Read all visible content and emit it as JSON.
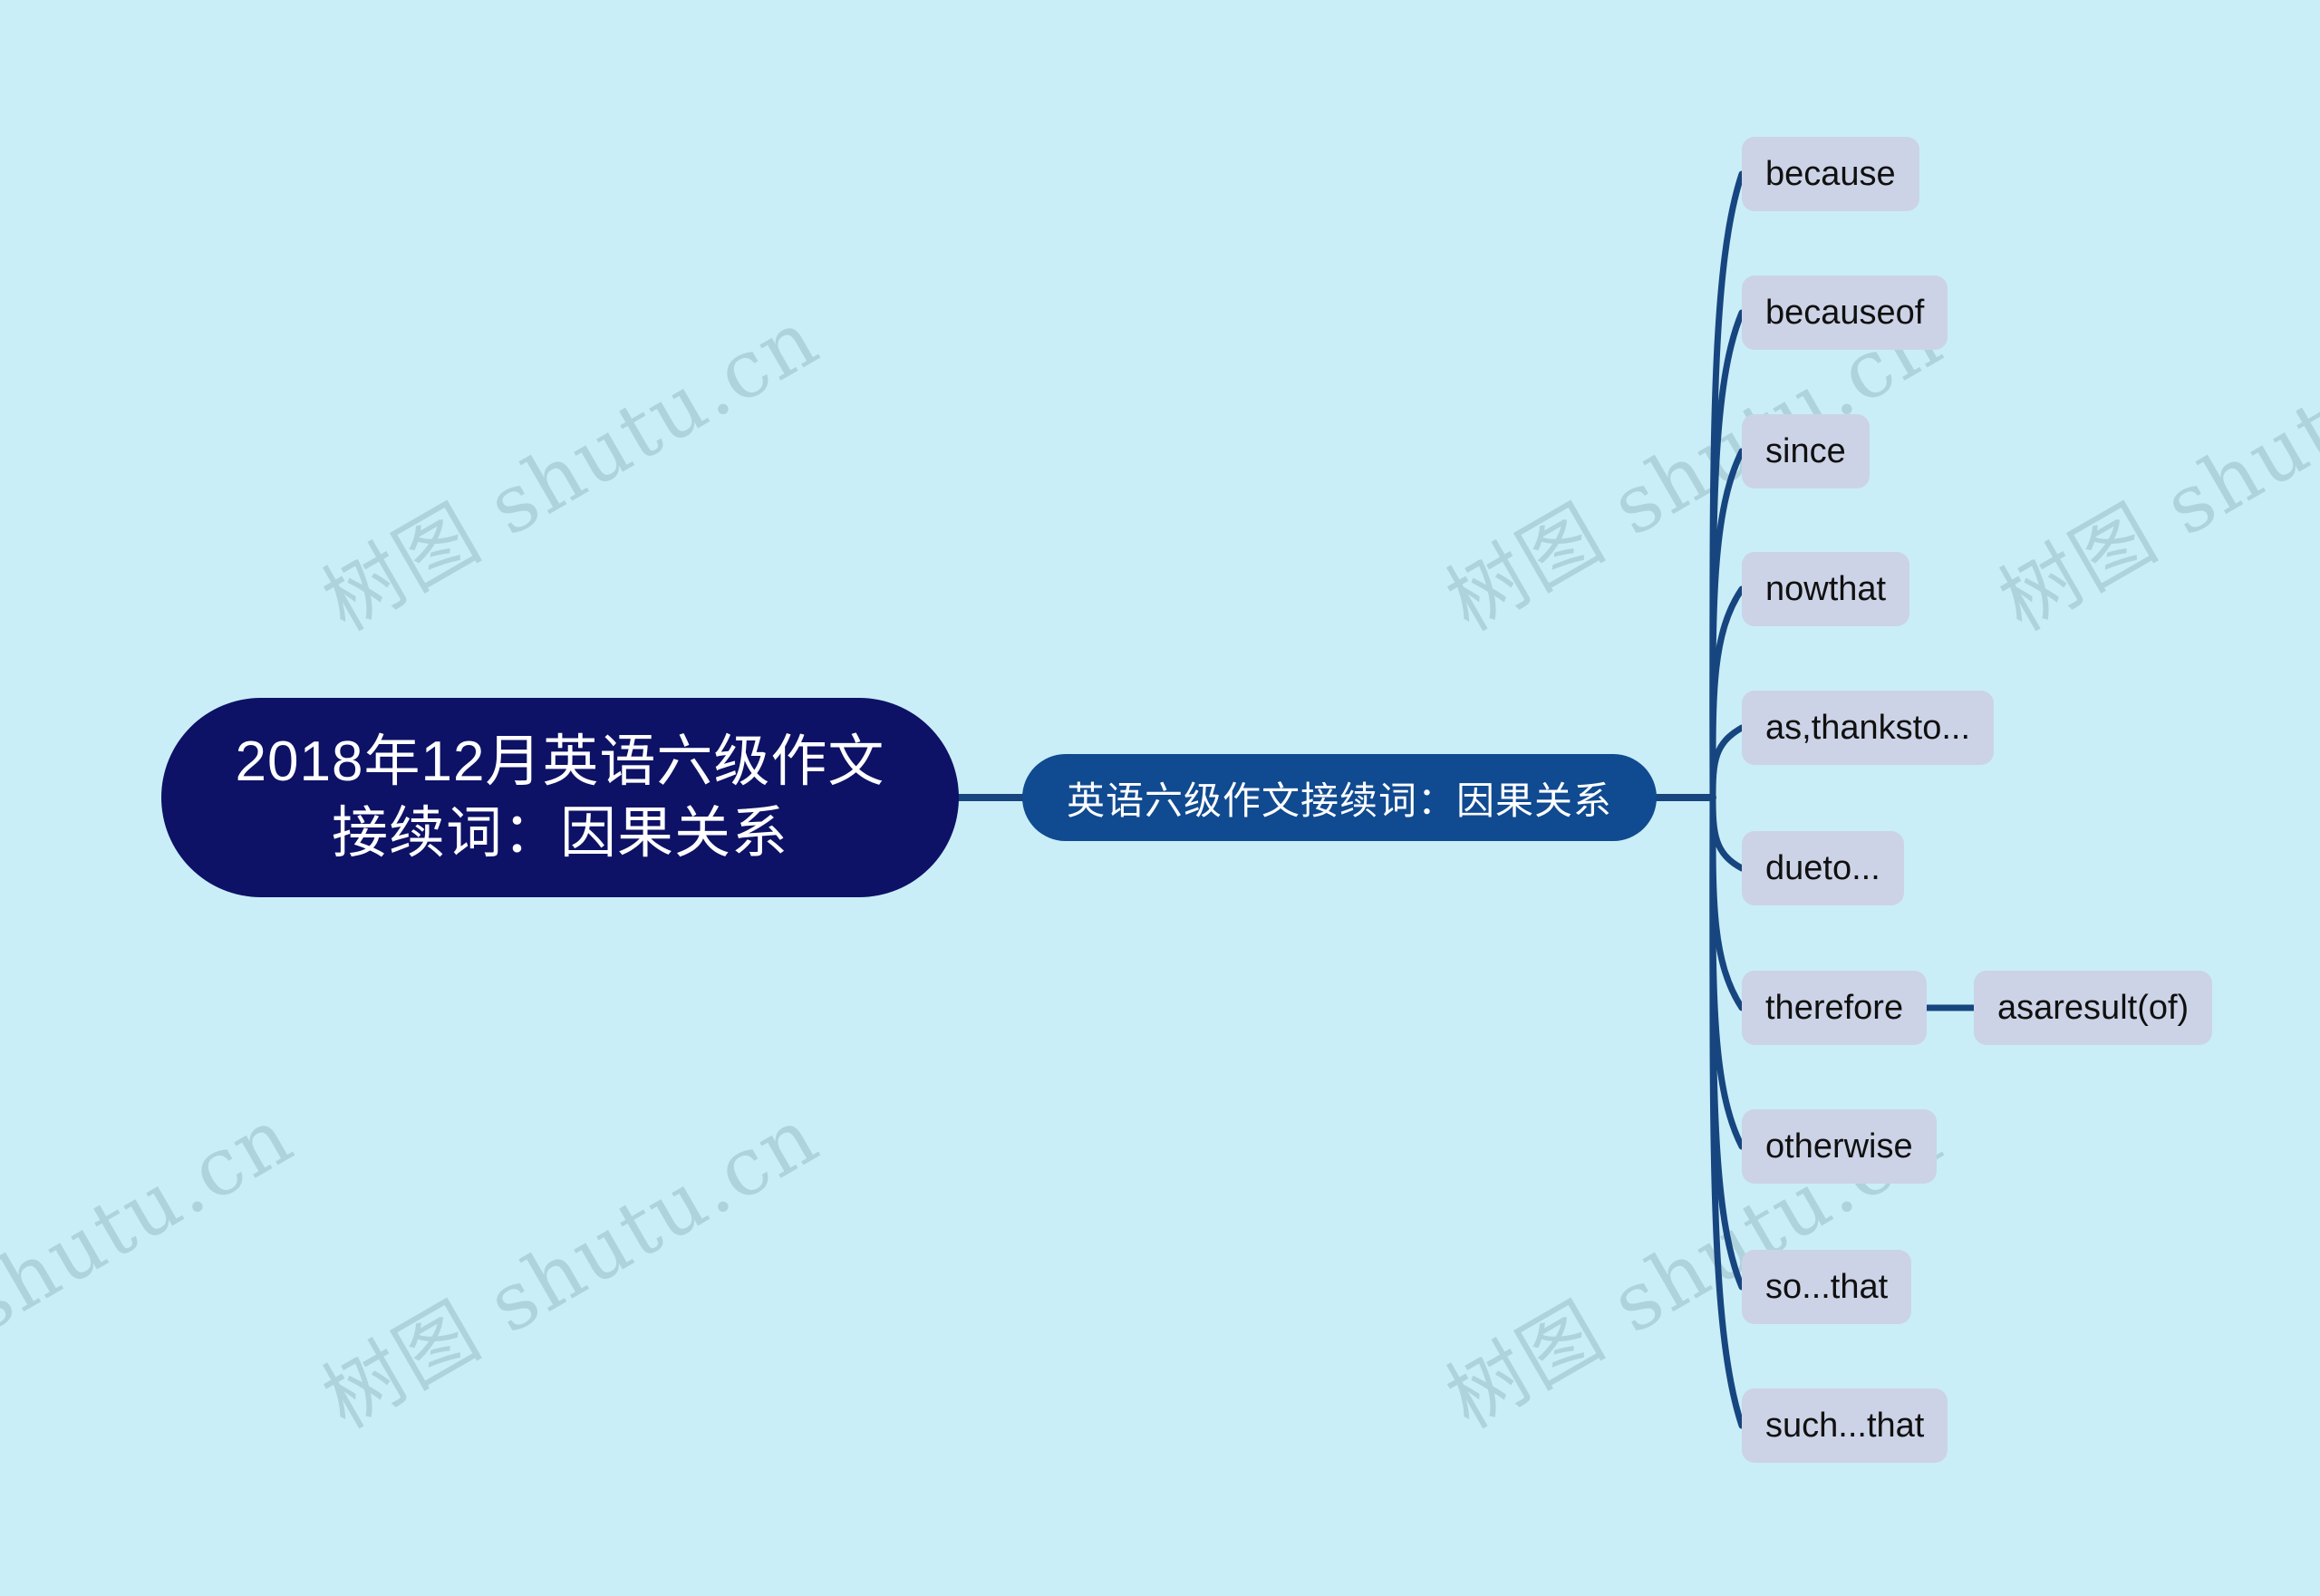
{
  "background_color": "#c9eef8",
  "watermark": {
    "text": "树图 shutu.cn",
    "color": "#9fc4cc",
    "rotation_deg": -30
  },
  "mindmap": {
    "type": "mindmap",
    "root": {
      "label": "2018年12月英语六级作文\n接续词：因果关系",
      "color": "#0d1266",
      "text_color": "#ffffff"
    },
    "branch": {
      "label": "英语六级作文接续词：因果关系",
      "color": "#104a90",
      "text_color": "#ffffff"
    },
    "leaf_color": "#ccd3e6",
    "leaf_text_color": "#101010",
    "connector_color": "#17457f",
    "leaves": [
      {
        "label": "because"
      },
      {
        "label": "becauseof"
      },
      {
        "label": "since"
      },
      {
        "label": "nowthat"
      },
      {
        "label": "as,thanksto..."
      },
      {
        "label": "dueto..."
      },
      {
        "label": "therefore"
      },
      {
        "label": "otherwise"
      },
      {
        "label": "so...that"
      },
      {
        "label": "such...that"
      }
    ],
    "sub_leaves": [
      {
        "parent": "therefore",
        "label": "asaresult(of)"
      }
    ]
  }
}
